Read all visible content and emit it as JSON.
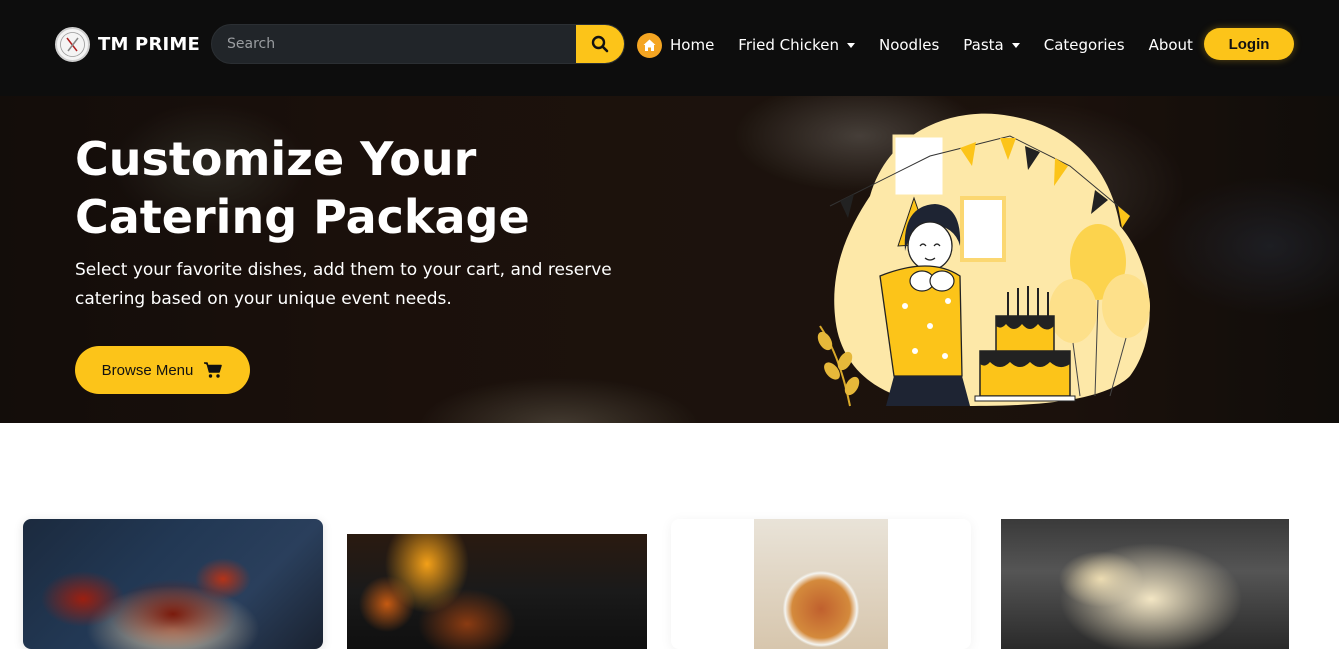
{
  "brand": {
    "name": "TM PRIME",
    "logo": "tm-prime-logo"
  },
  "search": {
    "placeholder": "Search",
    "value": "",
    "icon": "search-icon"
  },
  "nav": {
    "home_icon": "home-icon",
    "items": [
      {
        "label": "Home",
        "dropdown": false
      },
      {
        "label": "Fried Chicken",
        "dropdown": true
      },
      {
        "label": "Noodles",
        "dropdown": false
      },
      {
        "label": "Pasta",
        "dropdown": true
      },
      {
        "label": "Categories",
        "dropdown": false
      },
      {
        "label": "About",
        "dropdown": false
      }
    ],
    "login_label": "Login"
  },
  "hero": {
    "title": "Customize Your Catering Package",
    "subtitle": "Select your favorite dishes, add them to your cart, and reserve catering based on your unique event needs.",
    "cta_label": "Browse Menu",
    "cta_icon": "cart-icon",
    "illustration": "birthday-celebration-illustration"
  },
  "cards": [
    {
      "image": "spicy-chicken-dish-photo"
    },
    {
      "image": "flaming-fried-chicken-photo"
    },
    {
      "image": "stir-fried-noodles-photo"
    },
    {
      "image": "creamy-fettuccine-pasta-photo"
    }
  ],
  "colors": {
    "accent": "#fcc419",
    "navbar": "#0d0d0d",
    "home_icon_bg": "#f4a522"
  }
}
